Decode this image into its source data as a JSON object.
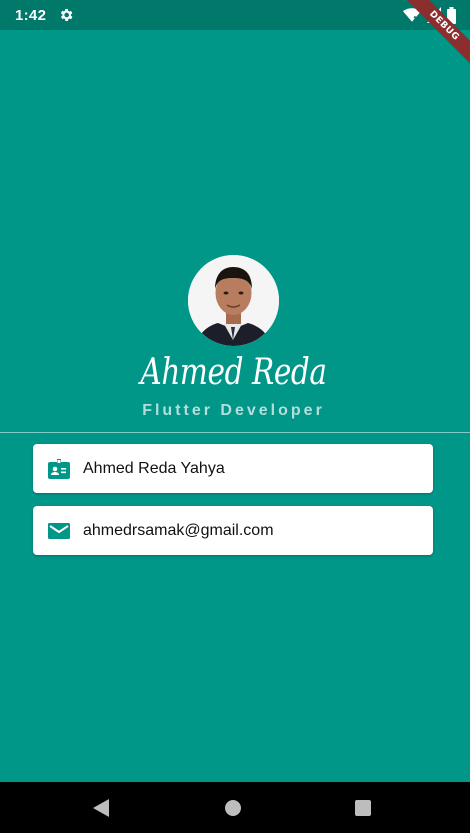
{
  "status_bar": {
    "time": "1:42",
    "icons": [
      "gear-icon",
      "wifi-icon",
      "signal-icon",
      "battery-icon"
    ]
  },
  "debug_banner": "DEBUG",
  "profile": {
    "name": "Ahmed Reda",
    "title": "Flutter Developer",
    "avatar_icon": "avatar-photo"
  },
  "cards": [
    {
      "icon": "contact-card-icon",
      "text": "Ahmed Reda Yahya"
    },
    {
      "icon": "email-icon",
      "text": "ahmedrsamak@gmail.com"
    }
  ],
  "nav_bar": {
    "icons": [
      "back-icon",
      "home-icon",
      "recents-icon"
    ]
  },
  "colors": {
    "background": "#009688",
    "status_bar": "#00796b",
    "accent": "#009688",
    "debug_ribbon": "#8b2e2e"
  }
}
